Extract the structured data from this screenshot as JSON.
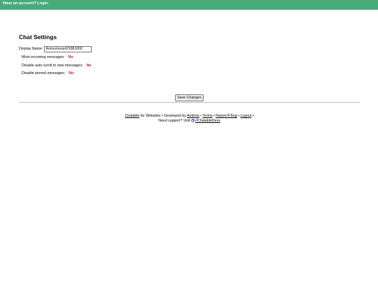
{
  "topbar": {
    "login_text": "Have an account? Login"
  },
  "settings": {
    "title": "Chat Settings",
    "display_name_label": "Display Name:",
    "display_name_value": "Anonymous#21861000",
    "options": [
      {
        "label": "Mute incoming messages:",
        "value": "No"
      },
      {
        "label": "Disable auto scroll to new messages:",
        "value": "No"
      },
      {
        "label": "Disable pinned messages:",
        "value": "No"
      }
    ],
    "save_label": "Save Changes"
  },
  "footer": {
    "brand_link": "Chatable",
    "for_websites": " for Websites • Developed by ",
    "developer_link": "Andrew",
    "sep1": " • ",
    "terms_link": "Terms",
    "sep2": " • ",
    "bug_link": "Report A Bug",
    "sep3": " • ",
    "logout_link": "Logout",
    "sep4": " •",
    "support_text": "Need support? Visit ",
    "subreddit_link": "r/ChatableDevs"
  },
  "colors": {
    "topbar": "#48ab7b",
    "option_value": "#e0141e"
  }
}
